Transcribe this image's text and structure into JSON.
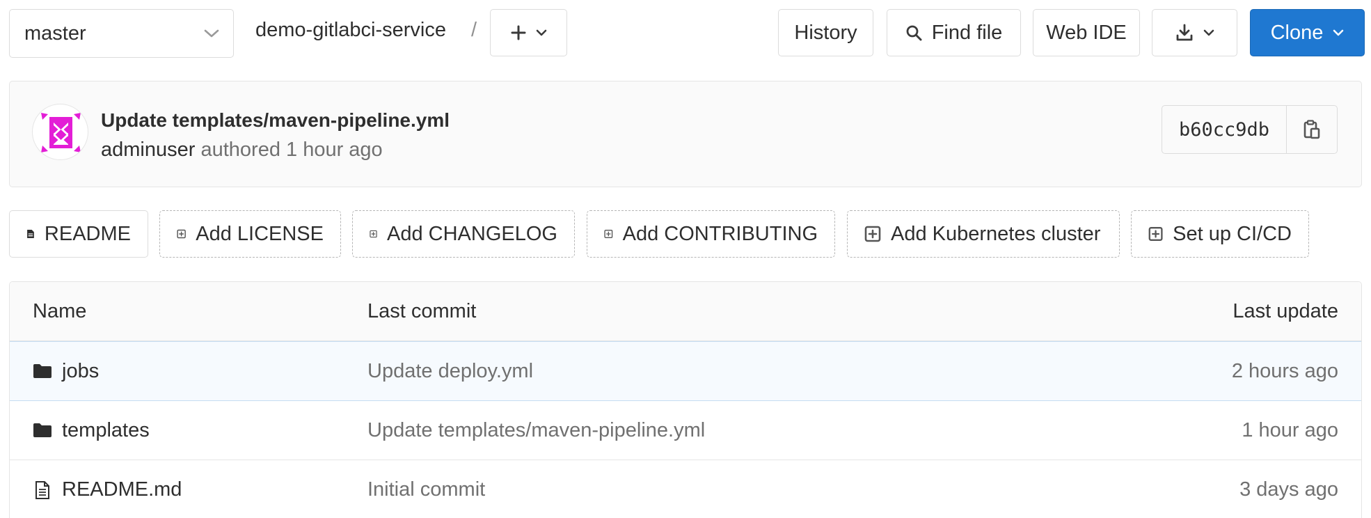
{
  "toolbar": {
    "branch": "master",
    "project": "demo-gitlabci-service",
    "separator": "/",
    "history_label": "History",
    "find_file_label": "Find file",
    "web_ide_label": "Web IDE",
    "clone_label": "Clone"
  },
  "commit": {
    "title": "Update templates/maven-pipeline.yml",
    "author": "adminuser",
    "meta": "authored 1 hour ago",
    "sha": "b60cc9db"
  },
  "shortcuts": [
    {
      "label": "README",
      "icon": "file-text-icon"
    },
    {
      "label": "Add LICENSE",
      "icon": "plus-square-icon"
    },
    {
      "label": "Add CHANGELOG",
      "icon": "plus-square-icon"
    },
    {
      "label": "Add CONTRIBUTING",
      "icon": "plus-square-icon"
    },
    {
      "label": "Add Kubernetes cluster",
      "icon": "plus-square-icon"
    },
    {
      "label": "Set up CI/CD",
      "icon": "plus-square-icon"
    }
  ],
  "table": {
    "headers": {
      "name": "Name",
      "last_commit": "Last commit",
      "last_update": "Last update"
    },
    "rows": [
      {
        "name": "jobs",
        "type": "folder",
        "last_commit": "Update deploy.yml",
        "last_update": "2 hours ago"
      },
      {
        "name": "templates",
        "type": "folder",
        "last_commit": "Update templates/maven-pipeline.yml",
        "last_update": "1 hour ago"
      },
      {
        "name": "README.md",
        "type": "file",
        "last_commit": "Initial commit",
        "last_update": "3 days ago"
      }
    ]
  },
  "colors": {
    "primary": "#1f78d1",
    "avatar_accent": "#e31ed6",
    "row_highlight": "#f6fafe"
  }
}
